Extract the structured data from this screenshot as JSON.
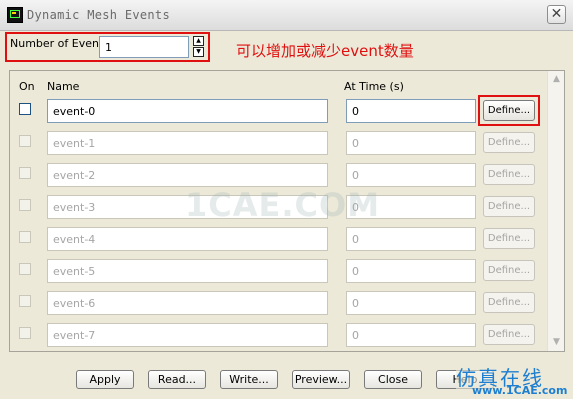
{
  "window": {
    "title": "Dynamic Mesh Events",
    "close_label": "✕"
  },
  "number_of_events": {
    "label": "Number of Events",
    "value": "1"
  },
  "annotation": "可以增加或减少event数量",
  "table": {
    "headers": {
      "on": "On",
      "name": "Name",
      "time": "At Time (s)"
    },
    "rows": [
      {
        "name": "event-0",
        "time": "0",
        "define": "Define...",
        "enabled": true,
        "checked": false
      },
      {
        "name": "event-1",
        "time": "0",
        "define": "Define...",
        "enabled": false,
        "checked": false
      },
      {
        "name": "event-2",
        "time": "0",
        "define": "Define...",
        "enabled": false,
        "checked": false
      },
      {
        "name": "event-3",
        "time": "0",
        "define": "Define...",
        "enabled": false,
        "checked": false
      },
      {
        "name": "event-4",
        "time": "0",
        "define": "Define...",
        "enabled": false,
        "checked": false
      },
      {
        "name": "event-5",
        "time": "0",
        "define": "Define...",
        "enabled": false,
        "checked": false
      },
      {
        "name": "event-6",
        "time": "0",
        "define": "Define...",
        "enabled": false,
        "checked": false
      },
      {
        "name": "event-7",
        "time": "0",
        "define": "Define...",
        "enabled": false,
        "checked": false
      }
    ]
  },
  "buttons": {
    "apply": "Apply",
    "read": "Read...",
    "write": "Write...",
    "preview": "Preview...",
    "close": "Close",
    "help": "Help"
  },
  "watermark": "1CAE.COM",
  "logo": {
    "chinese": "仿真在线",
    "url": "www.1CAE.com"
  }
}
